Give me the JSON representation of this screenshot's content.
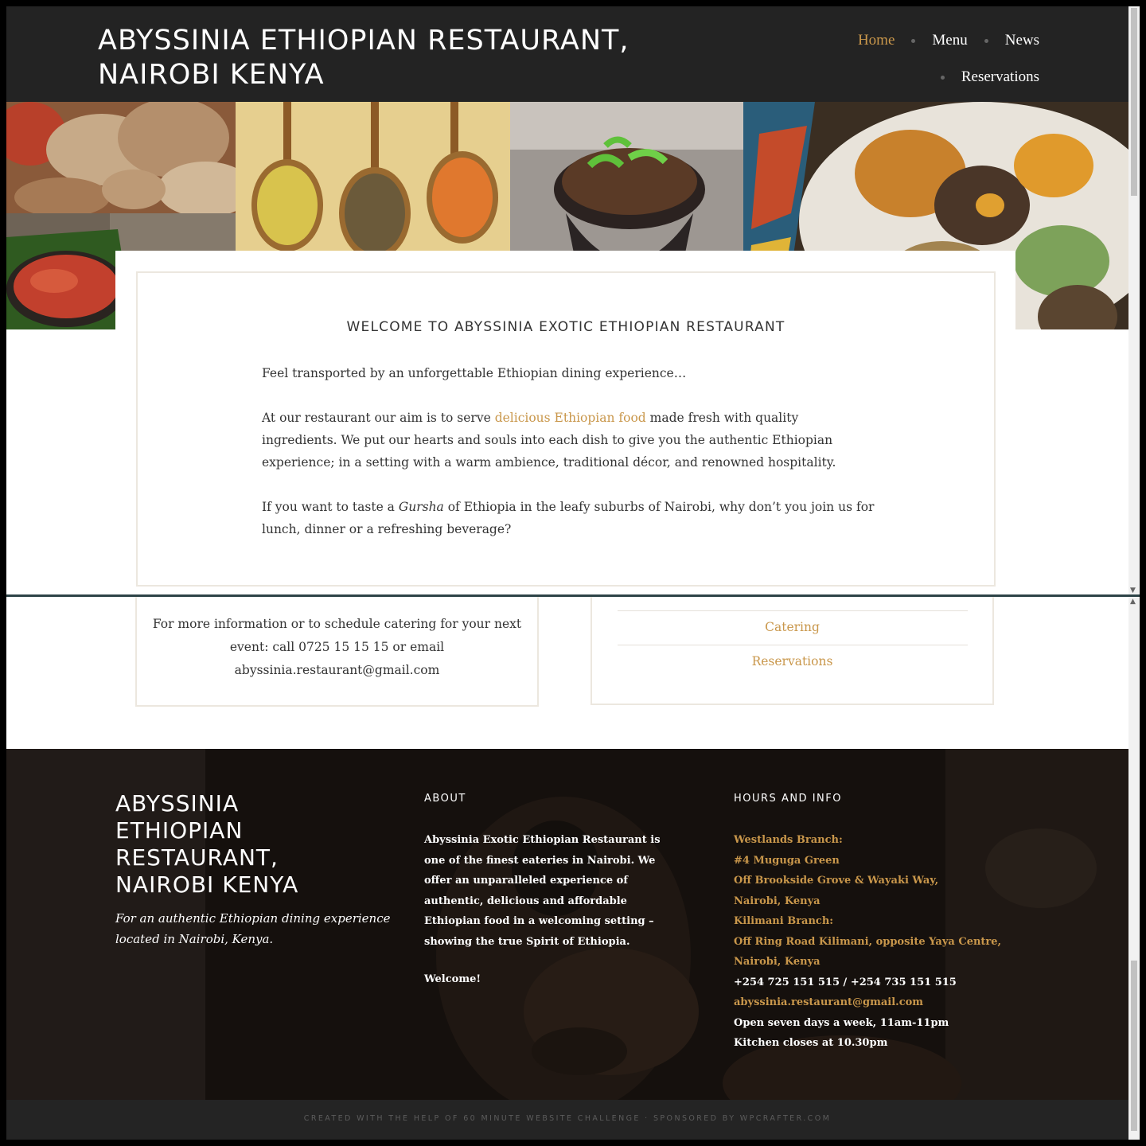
{
  "header": {
    "site_title_line1": "ABYSSINIA ETHIOPIAN RESTAURANT,",
    "site_title_line2": "NAIROBI KENYA"
  },
  "nav": {
    "items": [
      {
        "label": "Home",
        "active": true
      },
      {
        "label": "Menu",
        "active": false
      },
      {
        "label": "News",
        "active": false
      },
      {
        "label": "Reservations",
        "active": false
      }
    ]
  },
  "welcome": {
    "title": "WELCOME TO ABYSSINIA EXOTIC ETHIOPIAN RESTAURANT",
    "p1": "Feel transported by an unforgettable Ethiopian dining experience…",
    "p2_before": "At our restaurant our aim is to serve ",
    "p2_link": "delicious Ethiopian food",
    "p2_after": " made fresh with quality ingredients. We put our hearts and souls into each dish to give you the authentic Ethiopian experience; in a setting with a warm ambience, traditional décor, and renowned hospitality.",
    "p3_before": "If you want to taste a ",
    "p3_em": "Gursha",
    "p3_after": " of Ethiopia in the leafy suburbs of Nairobi, why don’t you join us for lunch, dinner or a refreshing beverage?"
  },
  "contact": {
    "text": "For more information or to schedule catering for your next event: call 0725 15 15 15 or email abyssinia.restaurant@gmail.com"
  },
  "links_card": {
    "catering": "Catering",
    "reservations": "Reservations"
  },
  "footer": {
    "title": "ABYSSINIA ETHIOPIAN RESTAURANT, NAIROBI KENYA",
    "tagline": "For an authentic Ethiopian dining experience located in Nairobi, Kenya.",
    "about_heading": "ABOUT",
    "about_text": "Abyssinia Exotic Ethiopian Restaurant is one of the finest eateries in Nairobi. We offer an unparalleled experience of authentic, delicious and affordable Ethiopian food in a welcoming setting – showing the true Spirit of Ethiopia.",
    "about_welcome": "Welcome!",
    "hours_heading": "HOURS AND INFO",
    "hours_lines": [
      "Westlands Branch:",
      "#4 Muguga Green",
      "Off Brookside Grove & Wayaki Way,",
      "Nairobi, Kenya",
      "Kilimani Branch:",
      "Off Ring Road Kilimani, opposite Yaya Centre,",
      "Nairobi, Kenya"
    ],
    "phones": "+254 725 151 515 / +254 735 151 515",
    "email": "abyssinia.restaurant@gmail.com",
    "open": "Open seven days a week, 11am-11pm",
    "kitchen": "Kitchen closes at 10.30pm"
  },
  "credits": "CREATED WITH THE HELP OF 60 MINUTE WEBSITE CHALLENGE · SPONSORED BY WPCRAFTER.COM",
  "colors": {
    "accent": "#c9974b",
    "header_bg": "#232323",
    "footer_bar": "#242424"
  }
}
